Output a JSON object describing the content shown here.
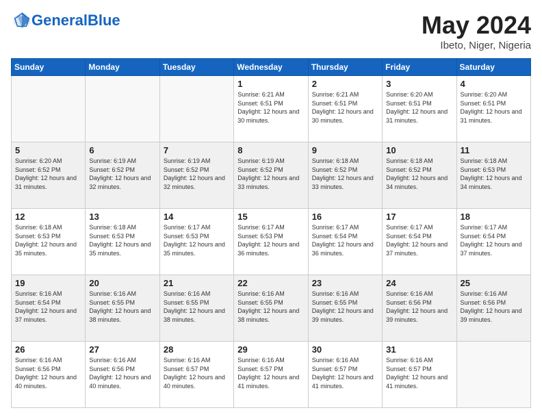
{
  "logo": {
    "text_general": "General",
    "text_blue": "Blue"
  },
  "header": {
    "title": "May 2024",
    "subtitle": "Ibeto, Niger, Nigeria"
  },
  "weekdays": [
    "Sunday",
    "Monday",
    "Tuesday",
    "Wednesday",
    "Thursday",
    "Friday",
    "Saturday"
  ],
  "weeks": [
    [
      {
        "day": "",
        "sunrise": "",
        "sunset": "",
        "daylight": ""
      },
      {
        "day": "",
        "sunrise": "",
        "sunset": "",
        "daylight": ""
      },
      {
        "day": "",
        "sunrise": "",
        "sunset": "",
        "daylight": ""
      },
      {
        "day": "1",
        "sunrise": "Sunrise: 6:21 AM",
        "sunset": "Sunset: 6:51 PM",
        "daylight": "Daylight: 12 hours and 30 minutes."
      },
      {
        "day": "2",
        "sunrise": "Sunrise: 6:21 AM",
        "sunset": "Sunset: 6:51 PM",
        "daylight": "Daylight: 12 hours and 30 minutes."
      },
      {
        "day": "3",
        "sunrise": "Sunrise: 6:20 AM",
        "sunset": "Sunset: 6:51 PM",
        "daylight": "Daylight: 12 hours and 31 minutes."
      },
      {
        "day": "4",
        "sunrise": "Sunrise: 6:20 AM",
        "sunset": "Sunset: 6:51 PM",
        "daylight": "Daylight: 12 hours and 31 minutes."
      }
    ],
    [
      {
        "day": "5",
        "sunrise": "Sunrise: 6:20 AM",
        "sunset": "Sunset: 6:52 PM",
        "daylight": "Daylight: 12 hours and 31 minutes."
      },
      {
        "day": "6",
        "sunrise": "Sunrise: 6:19 AM",
        "sunset": "Sunset: 6:52 PM",
        "daylight": "Daylight: 12 hours and 32 minutes."
      },
      {
        "day": "7",
        "sunrise": "Sunrise: 6:19 AM",
        "sunset": "Sunset: 6:52 PM",
        "daylight": "Daylight: 12 hours and 32 minutes."
      },
      {
        "day": "8",
        "sunrise": "Sunrise: 6:19 AM",
        "sunset": "Sunset: 6:52 PM",
        "daylight": "Daylight: 12 hours and 33 minutes."
      },
      {
        "day": "9",
        "sunrise": "Sunrise: 6:18 AM",
        "sunset": "Sunset: 6:52 PM",
        "daylight": "Daylight: 12 hours and 33 minutes."
      },
      {
        "day": "10",
        "sunrise": "Sunrise: 6:18 AM",
        "sunset": "Sunset: 6:52 PM",
        "daylight": "Daylight: 12 hours and 34 minutes."
      },
      {
        "day": "11",
        "sunrise": "Sunrise: 6:18 AM",
        "sunset": "Sunset: 6:53 PM",
        "daylight": "Daylight: 12 hours and 34 minutes."
      }
    ],
    [
      {
        "day": "12",
        "sunrise": "Sunrise: 6:18 AM",
        "sunset": "Sunset: 6:53 PM",
        "daylight": "Daylight: 12 hours and 35 minutes."
      },
      {
        "day": "13",
        "sunrise": "Sunrise: 6:18 AM",
        "sunset": "Sunset: 6:53 PM",
        "daylight": "Daylight: 12 hours and 35 minutes."
      },
      {
        "day": "14",
        "sunrise": "Sunrise: 6:17 AM",
        "sunset": "Sunset: 6:53 PM",
        "daylight": "Daylight: 12 hours and 35 minutes."
      },
      {
        "day": "15",
        "sunrise": "Sunrise: 6:17 AM",
        "sunset": "Sunset: 6:53 PM",
        "daylight": "Daylight: 12 hours and 36 minutes."
      },
      {
        "day": "16",
        "sunrise": "Sunrise: 6:17 AM",
        "sunset": "Sunset: 6:54 PM",
        "daylight": "Daylight: 12 hours and 36 minutes."
      },
      {
        "day": "17",
        "sunrise": "Sunrise: 6:17 AM",
        "sunset": "Sunset: 6:54 PM",
        "daylight": "Daylight: 12 hours and 37 minutes."
      },
      {
        "day": "18",
        "sunrise": "Sunrise: 6:17 AM",
        "sunset": "Sunset: 6:54 PM",
        "daylight": "Daylight: 12 hours and 37 minutes."
      }
    ],
    [
      {
        "day": "19",
        "sunrise": "Sunrise: 6:16 AM",
        "sunset": "Sunset: 6:54 PM",
        "daylight": "Daylight: 12 hours and 37 minutes."
      },
      {
        "day": "20",
        "sunrise": "Sunrise: 6:16 AM",
        "sunset": "Sunset: 6:55 PM",
        "daylight": "Daylight: 12 hours and 38 minutes."
      },
      {
        "day": "21",
        "sunrise": "Sunrise: 6:16 AM",
        "sunset": "Sunset: 6:55 PM",
        "daylight": "Daylight: 12 hours and 38 minutes."
      },
      {
        "day": "22",
        "sunrise": "Sunrise: 6:16 AM",
        "sunset": "Sunset: 6:55 PM",
        "daylight": "Daylight: 12 hours and 38 minutes."
      },
      {
        "day": "23",
        "sunrise": "Sunrise: 6:16 AM",
        "sunset": "Sunset: 6:55 PM",
        "daylight": "Daylight: 12 hours and 39 minutes."
      },
      {
        "day": "24",
        "sunrise": "Sunrise: 6:16 AM",
        "sunset": "Sunset: 6:56 PM",
        "daylight": "Daylight: 12 hours and 39 minutes."
      },
      {
        "day": "25",
        "sunrise": "Sunrise: 6:16 AM",
        "sunset": "Sunset: 6:56 PM",
        "daylight": "Daylight: 12 hours and 39 minutes."
      }
    ],
    [
      {
        "day": "26",
        "sunrise": "Sunrise: 6:16 AM",
        "sunset": "Sunset: 6:56 PM",
        "daylight": "Daylight: 12 hours and 40 minutes."
      },
      {
        "day": "27",
        "sunrise": "Sunrise: 6:16 AM",
        "sunset": "Sunset: 6:56 PM",
        "daylight": "Daylight: 12 hours and 40 minutes."
      },
      {
        "day": "28",
        "sunrise": "Sunrise: 6:16 AM",
        "sunset": "Sunset: 6:57 PM",
        "daylight": "Daylight: 12 hours and 40 minutes."
      },
      {
        "day": "29",
        "sunrise": "Sunrise: 6:16 AM",
        "sunset": "Sunset: 6:57 PM",
        "daylight": "Daylight: 12 hours and 41 minutes."
      },
      {
        "day": "30",
        "sunrise": "Sunrise: 6:16 AM",
        "sunset": "Sunset: 6:57 PM",
        "daylight": "Daylight: 12 hours and 41 minutes."
      },
      {
        "day": "31",
        "sunrise": "Sunrise: 6:16 AM",
        "sunset": "Sunset: 6:57 PM",
        "daylight": "Daylight: 12 hours and 41 minutes."
      },
      {
        "day": "",
        "sunrise": "",
        "sunset": "",
        "daylight": ""
      }
    ]
  ]
}
